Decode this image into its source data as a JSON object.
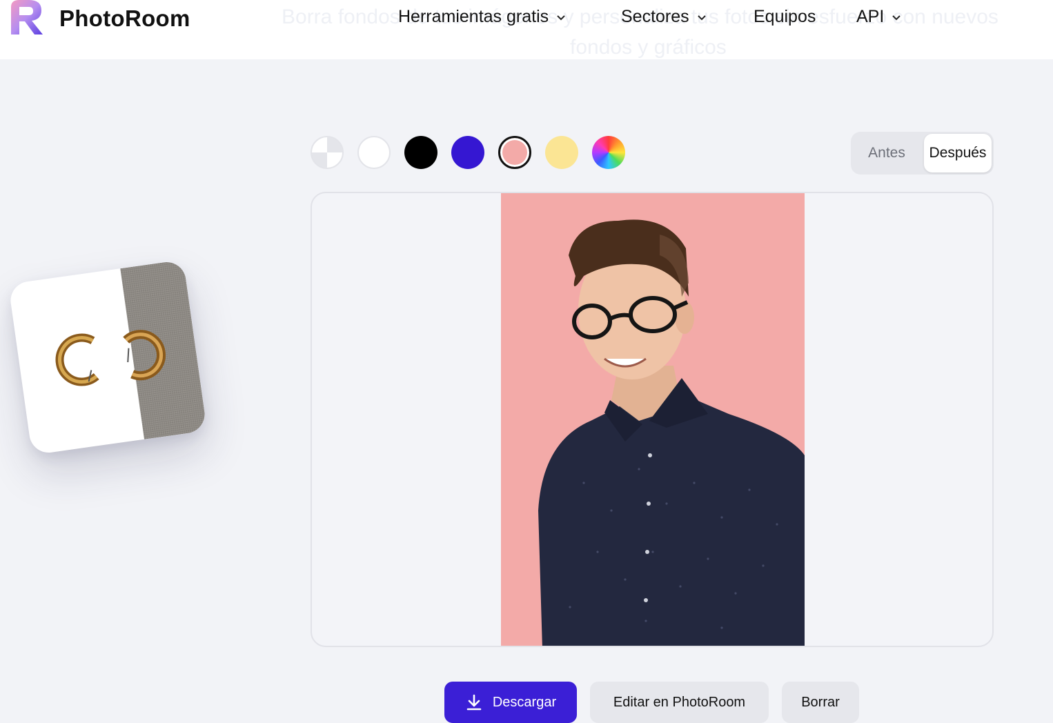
{
  "brand": {
    "name": "PhotoRoom"
  },
  "hero_background_text": {
    "line1": "Borra fondos de tus imágenes y personaliza tus fotos sin esfuerzo con nuevos",
    "line2": "fondos y gráficos"
  },
  "nav": {
    "items": [
      {
        "label": "Herramientas gratis",
        "has_dropdown": true
      },
      {
        "label": "Sectores",
        "has_dropdown": true
      },
      {
        "label": "Equipos",
        "has_dropdown": false
      },
      {
        "label": "API",
        "has_dropdown": true
      }
    ]
  },
  "background_swatches": [
    {
      "name": "transparent",
      "color": "#ffffff"
    },
    {
      "name": "white",
      "color": "#ffffff"
    },
    {
      "name": "black",
      "color": "#000000"
    },
    {
      "name": "blue",
      "color": "#3517d2"
    },
    {
      "name": "pink",
      "color": "#f3aaa8",
      "selected": true
    },
    {
      "name": "yellow",
      "color": "#fbe594"
    },
    {
      "name": "custom-color-picker",
      "color": "rainbow"
    }
  ],
  "view_toggle": {
    "before_label": "Antes",
    "after_label": "Después",
    "active": "Después"
  },
  "preview": {
    "background_color": "#f3aaa8",
    "subject": "portrait-man-glasses-navy-shirt"
  },
  "example_card": {
    "subject": "gold-hoop-earrings"
  },
  "actions": {
    "download_label": "Descargar",
    "edit_label": "Editar en PhotoRoom",
    "delete_label": "Borrar"
  },
  "colors": {
    "accent": "#3b1fd6",
    "page_bg": "#f2f3f7",
    "header_bg": "#ffffff"
  }
}
